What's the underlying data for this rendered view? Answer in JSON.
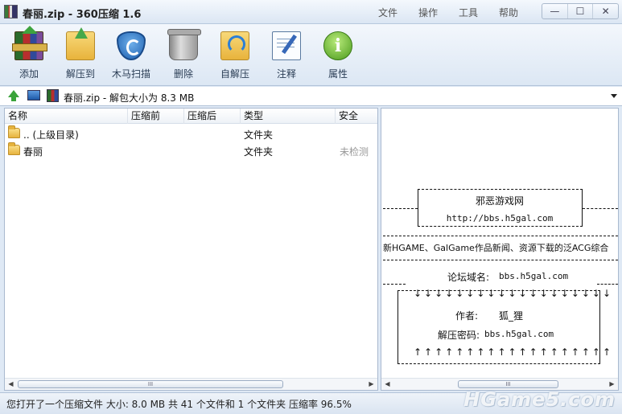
{
  "window": {
    "title": "春丽.zip - 360压缩 1.6",
    "controls": {
      "minimize": "—",
      "maximize": "☐",
      "close": "✕"
    }
  },
  "menu": [
    "文件",
    "操作",
    "工具",
    "帮助"
  ],
  "toolbar": [
    {
      "label": "添加",
      "icon": "add-archive-icon"
    },
    {
      "label": "解压到",
      "icon": "extract-folder-icon"
    },
    {
      "label": "木马扫描",
      "icon": "shield-icon"
    },
    {
      "label": "删除",
      "icon": "trash-icon"
    },
    {
      "label": "自解压",
      "icon": "self-extract-icon"
    },
    {
      "label": "注释",
      "icon": "comment-icon"
    },
    {
      "label": "属性",
      "icon": "info-icon"
    }
  ],
  "address": {
    "text": "春丽.zip - 解包大小为 8.3 MB"
  },
  "file_list": {
    "columns": [
      "名称",
      "压缩前",
      "压缩后",
      "类型",
      "安全"
    ],
    "rows": [
      {
        "name": ".. (上级目录)",
        "before": "",
        "after": "",
        "type": "文件夹",
        "safety": ""
      },
      {
        "name": "春丽",
        "before": "",
        "after": "",
        "type": "文件夹",
        "safety": "未检测"
      }
    ]
  },
  "preview": {
    "box_title": "邪恶游戏网",
    "box_url": "http://bbs.h5gal.com",
    "description": "新HGAME、GalGame作品新闻、资源下载的泛ACG综合",
    "domain_label": "论坛域名:",
    "domain_value": "bbs.h5gal.com",
    "down_arrows": "↓↓↓↓↓↓↓↓↓↓↓↓↓↓↓↓↓↓↓",
    "author_label": "作者:",
    "author_value": "狐_狸",
    "password_label": "解压密码:",
    "password_value": "bbs.h5gal.com",
    "up_arrows": "↑↑↑↑↑↑↑↑↑↑↑↑↑↑↑↑↑↑↑"
  },
  "status": {
    "text": "您打开了一个压缩文件 大小: 8.0 MB 共 41 个文件和 1 个文件夹 压缩率 96.5%"
  },
  "watermark": "HGame5.com",
  "scroll": {
    "left_arrow": "◀",
    "right_arrow": "▶",
    "thumb_grip": "III"
  }
}
